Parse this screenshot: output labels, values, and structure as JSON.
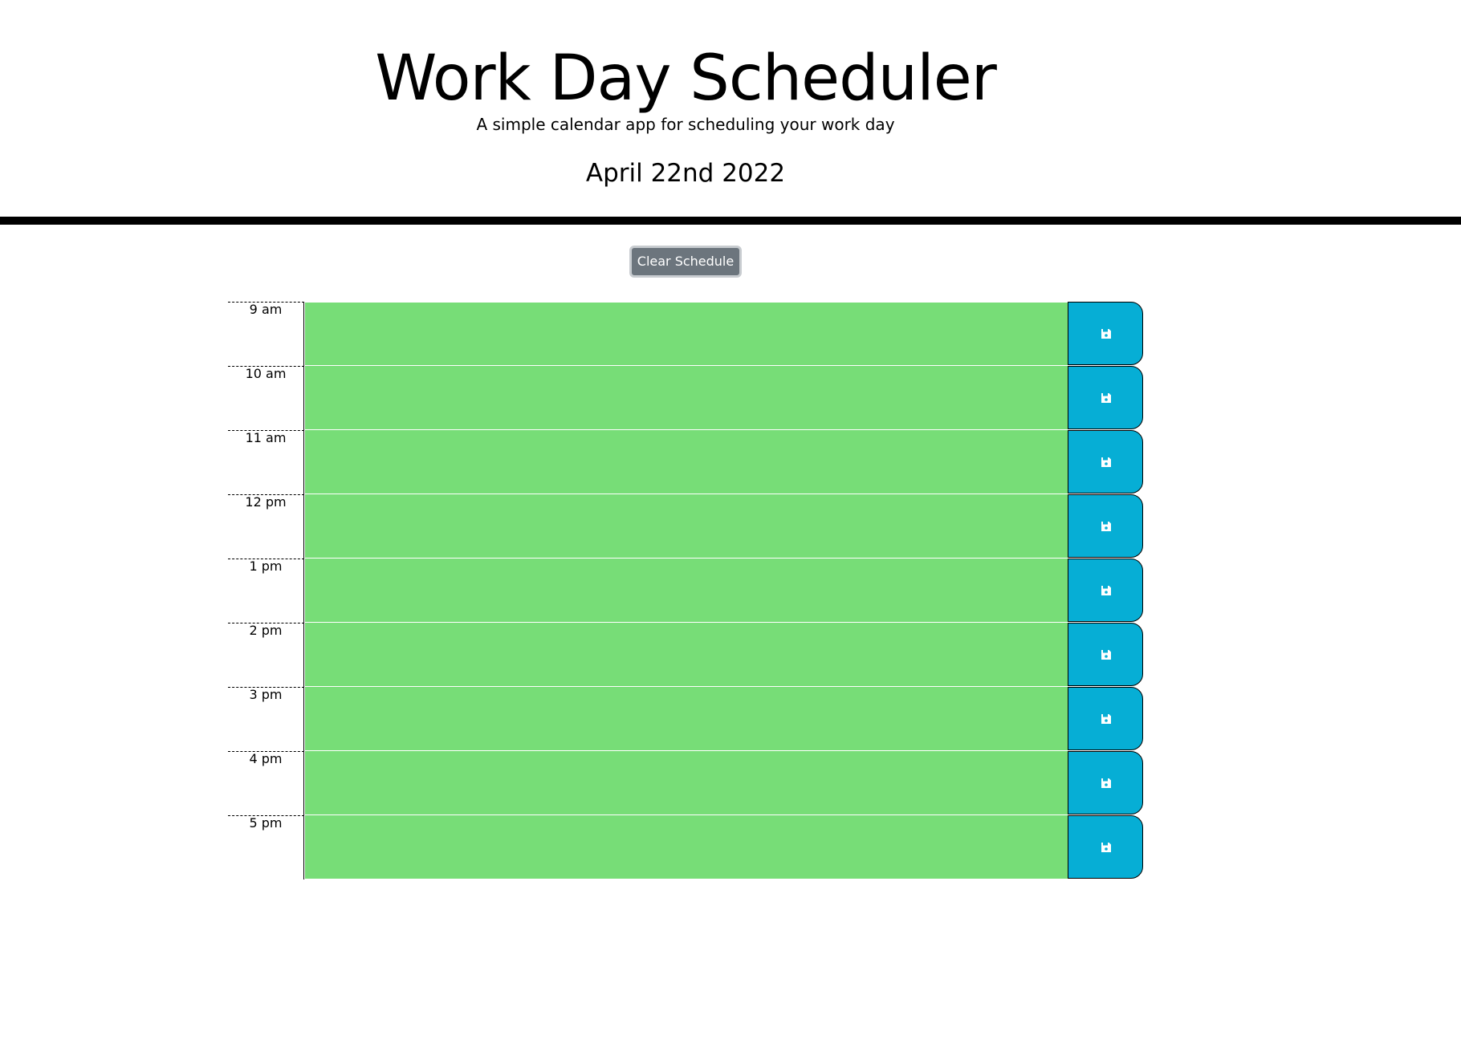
{
  "header": {
    "title": "Work Day Scheduler",
    "subtitle": "A simple calendar app for scheduling your work day",
    "current_date": "April 22nd 2022"
  },
  "controls": {
    "clear_label": "Clear Schedule"
  },
  "schedule": {
    "slots": [
      {
        "hour": "9 am",
        "text": "",
        "status": "future"
      },
      {
        "hour": "10 am",
        "text": "",
        "status": "future"
      },
      {
        "hour": "11 am",
        "text": "",
        "status": "future"
      },
      {
        "hour": "12 pm",
        "text": "",
        "status": "future"
      },
      {
        "hour": "1 pm",
        "text": "",
        "status": "future"
      },
      {
        "hour": "2 pm",
        "text": "",
        "status": "future"
      },
      {
        "hour": "3 pm",
        "text": "",
        "status": "future"
      },
      {
        "hour": "4 pm",
        "text": "",
        "status": "future"
      },
      {
        "hour": "5 pm",
        "text": "",
        "status": "future"
      }
    ],
    "save_icon": "floppy-disk-icon"
  },
  "colors": {
    "future": "#77dd77",
    "save_button": "#06aed5",
    "clear_button": "#6c757d"
  }
}
